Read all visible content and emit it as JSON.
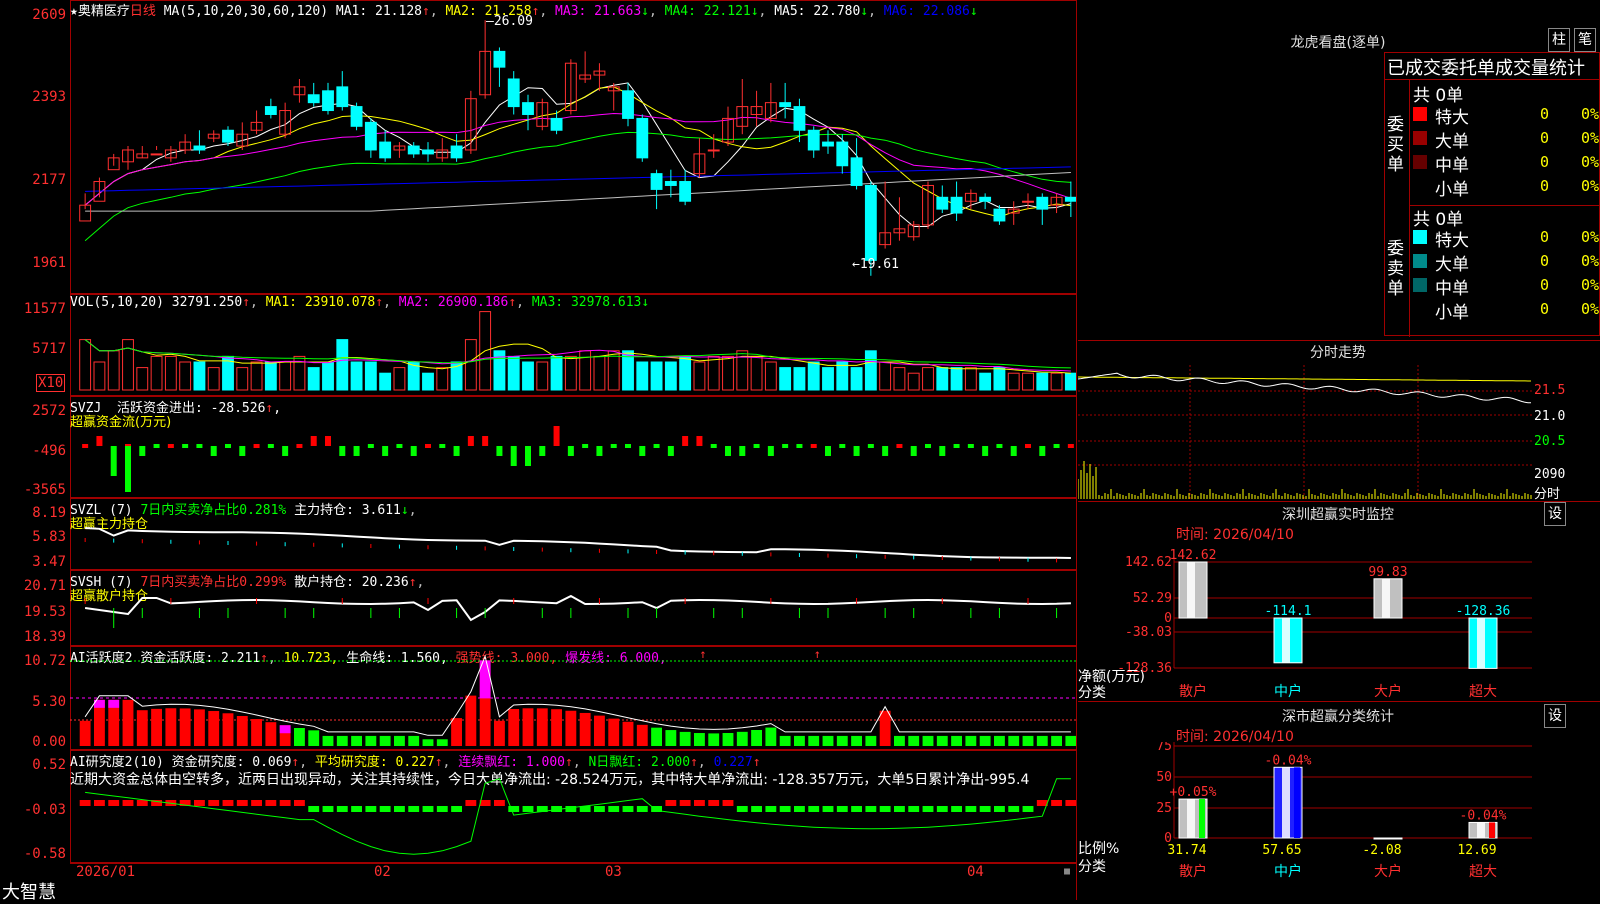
{
  "stock": {
    "name": "奥精医疗",
    "period": "日线",
    "star": "★"
  },
  "ma_header": {
    "label": "MA(5,10,20,30,60,120)",
    "ma1": "MA1: 21.128",
    "ma2": "MA2: 21.258",
    "ma3": "MA3: 21.663",
    "ma4": "MA4: 22.121",
    "ma5": "MA5: 22.780",
    "ma6": "MA6: 22.086"
  },
  "price_axis": [
    "2609",
    "2393",
    "2177",
    "1961"
  ],
  "annotations": {
    "high": "26.09",
    "low": "19.61"
  },
  "vol_header": {
    "label": "VOL(5,10,20)",
    "value": "32791.250",
    "ma1": "MA1: 23910.078",
    "ma2": "MA2: 26900.186",
    "ma3": "MA3: 32978.613"
  },
  "vol_axis": [
    "11577",
    "5717"
  ],
  "vol_unit": "X10",
  "svzj": {
    "label": "SVZJ",
    "text": "活跃资金进出: -28.526",
    "sub": "超赢资金流(万元)",
    "axis": [
      "2572",
      "-496",
      "-3565"
    ]
  },
  "svzl": {
    "label": "SVZL (7)",
    "text1": "7日内买卖净占比0.281%",
    "text2": "主力持仓: 3.611",
    "sub": "超赢主力持仓",
    "axis": [
      "8.19",
      "5.83",
      "3.47"
    ]
  },
  "svsh": {
    "label": "SVSH (7)",
    "text1": "7日内买卖净占比0.299%",
    "text2": "散户持仓: 20.236",
    "sub": "超赢散户持仓",
    "axis": [
      "20.71",
      "19.53",
      "18.39"
    ]
  },
  "ai1": {
    "label": "AI活跃度2",
    "t1": "资金活跃度: 2.211",
    "t2": "10.723,",
    "t3": "生命线: 1.560,",
    "t4": "强势线: 3.000,",
    "t5": "爆发线: 6.000,",
    "axis": [
      "10.72",
      "5.30",
      "0.00"
    ]
  },
  "ai2": {
    "label": "AI研究度2(10)",
    "t1": "资金研究度: 0.069",
    "t2": "平均研究度: 0.227",
    "t3": "连续飘红: 1.000",
    "t4": "N日飘红: 2.000",
    "t5": "0.227",
    "comment": "近期大资金总体由空转多，近两日出现异动，关注其持续性，今日大单净流出: -28.524万元，其中特大单净流出: -128.357万元，大单5日累计净出-995.4",
    "axis": [
      "0.52",
      "-0.03",
      "-0.58"
    ]
  },
  "date_axis": [
    "2026/01",
    "02",
    "03",
    "04"
  ],
  "brand": "大智慧",
  "right": {
    "lh_title": "龙虎看盘(逐单)",
    "btn_bar": "柱",
    "btn_pen": "笔",
    "stats_title": "已成交委托单成交量统计",
    "buy_label": "委买单",
    "sell_label": "委卖单",
    "buy_total": "共 0单",
    "sell_total": "共 0单",
    "buy_rows": [
      {
        "name": "特大",
        "count": "0",
        "pct": "0%",
        "color": "#ff0000"
      },
      {
        "name": "大单",
        "count": "0",
        "pct": "0%",
        "color": "#990000"
      },
      {
        "name": "中单",
        "count": "0",
        "pct": "0%",
        "color": "#660000"
      },
      {
        "name": "小单",
        "count": "0",
        "pct": "0%",
        "color": "#000000"
      }
    ],
    "sell_rows": [
      {
        "name": "特大",
        "count": "0",
        "pct": "0%",
        "color": "#00ffff"
      },
      {
        "name": "大单",
        "count": "0",
        "pct": "0%",
        "color": "#008b8b"
      },
      {
        "name": "中单",
        "count": "0",
        "pct": "0%",
        "color": "#006666"
      },
      {
        "name": "小单",
        "count": "0",
        "pct": "0%",
        "color": "#000000"
      }
    ],
    "fs_title": "分时走势",
    "fs_axis": [
      "21.5",
      "21.0",
      "20.5"
    ],
    "fs_vol": [
      "2090",
      "分时"
    ],
    "sz_title": "深圳超赢实时监控",
    "sz_time": "时间: 2026/04/10",
    "sz_axis": [
      "142.62",
      "52.29",
      "0",
      "-38.03",
      "-128.36"
    ],
    "sz_ylabel": "净额(万元)",
    "sz_xlabel": "分类",
    "sz_bars": [
      {
        "cat": "散户",
        "value": 142.62,
        "label": "142.62"
      },
      {
        "cat": "中户",
        "value": -114.1,
        "label": "-114.1"
      },
      {
        "cat": "大户",
        "value": 99.83,
        "label": "99.83"
      },
      {
        "cat": "超大",
        "value": -128.36,
        "label": "-128.36"
      }
    ],
    "sc_title": "深市超赢分类统计",
    "sc_time": "时间: 2026/04/10",
    "sc_axis": [
      "75",
      "50",
      "25",
      "0"
    ],
    "sc_ylabel": "比例%",
    "sc_xlabel": "分类",
    "sc_bars": [
      {
        "cat": "散户",
        "value": 31.74,
        "label": "31.74",
        "change": "+0.05%"
      },
      {
        "cat": "中户",
        "value": 57.65,
        "label": "57.65",
        "change": "-0.04%"
      },
      {
        "cat": "大户",
        "value": -2.08,
        "label": "-2.08",
        "change": ""
      },
      {
        "cat": "超大",
        "value": 12.69,
        "label": "12.69",
        "change": "-0.04%"
      }
    ],
    "btn_set": "设"
  },
  "colors": {
    "up": "#ff3030",
    "down": "#00ffff",
    "ma_white": "#ffffff",
    "ma_yellow": "#ffff00",
    "ma_magenta": "#ff00ff",
    "ma_green": "#00ff00",
    "ma_blue": "#0000ff",
    "ma_gray": "#c0c0c0"
  },
  "chart_data": {
    "type": "candlestick",
    "candles": [
      [
        21.0,
        21.4,
        21.3,
        21.7
      ],
      [
        21.5,
        22.0,
        21.6,
        22.1
      ],
      [
        22.3,
        22.6,
        22.4,
        22.7
      ],
      [
        22.5,
        22.8,
        22.3,
        22.9
      ],
      [
        22.6,
        22.7,
        22.6,
        22.9
      ],
      [
        22.7,
        22.7,
        22.8,
        22.9
      ],
      [
        22.6,
        22.8,
        22.5,
        22.9
      ],
      [
        22.8,
        23.0,
        22.7,
        23.2
      ],
      [
        22.9,
        22.8,
        22.7,
        23.3
      ],
      [
        23.1,
        23.2,
        23.0,
        23.3
      ],
      [
        23.3,
        23.0,
        22.9,
        23.4
      ],
      [
        22.9,
        23.2,
        22.8,
        23.5
      ],
      [
        23.3,
        23.5,
        23.2,
        23.8
      ],
      [
        23.9,
        23.7,
        23.6,
        24.1
      ],
      [
        23.2,
        23.8,
        23.1,
        24.0
      ],
      [
        24.2,
        24.4,
        24.0,
        24.6
      ],
      [
        24.2,
        24.0,
        23.9,
        24.5
      ],
      [
        24.3,
        23.8,
        23.7,
        24.5
      ],
      [
        24.4,
        23.9,
        23.8,
        24.8
      ],
      [
        23.9,
        23.4,
        23.3,
        24.0
      ],
      [
        23.5,
        22.8,
        22.6,
        23.6
      ],
      [
        23.0,
        22.6,
        22.5,
        23.3
      ],
      [
        22.8,
        22.9,
        22.6,
        23.0
      ],
      [
        22.9,
        22.7,
        22.6,
        23.0
      ],
      [
        22.8,
        22.7,
        22.5,
        23.0
      ],
      [
        22.6,
        22.8,
        22.5,
        23.1
      ],
      [
        22.9,
        22.6,
        22.5,
        23.2
      ],
      [
        22.8,
        24.1,
        22.7,
        24.3
      ],
      [
        24.2,
        25.3,
        24.1,
        26.09
      ],
      [
        25.3,
        24.9,
        24.4,
        25.4
      ],
      [
        24.6,
        23.9,
        23.7,
        24.8
      ],
      [
        24.0,
        23.7,
        23.3,
        24.2
      ],
      [
        23.4,
        24.0,
        23.3,
        24.1
      ],
      [
        23.6,
        23.3,
        23.2,
        23.8
      ],
      [
        23.8,
        25.0,
        23.7,
        25.1
      ],
      [
        24.6,
        24.7,
        24.5,
        25.3
      ],
      [
        24.7,
        24.8,
        24.3,
        25.0
      ],
      [
        24.3,
        24.4,
        23.8,
        24.5
      ],
      [
        24.3,
        23.6,
        23.4,
        24.5
      ],
      [
        23.6,
        22.6,
        22.5,
        23.7
      ],
      [
        22.2,
        21.8,
        21.3,
        22.3
      ],
      [
        22.0,
        21.9,
        21.6,
        22.3
      ],
      [
        22.0,
        21.5,
        21.4,
        22.3
      ],
      [
        22.2,
        22.7,
        22.1,
        23.1
      ],
      [
        22.8,
        22.8,
        22.6,
        23.2
      ],
      [
        23.0,
        23.6,
        22.9,
        23.9
      ],
      [
        23.4,
        23.9,
        23.2,
        24.6
      ],
      [
        23.7,
        23.9,
        23.4,
        24.3
      ],
      [
        23.6,
        24.0,
        23.5,
        24.5
      ],
      [
        24.0,
        23.9,
        23.6,
        24.5
      ],
      [
        23.9,
        23.3,
        23.0,
        24.1
      ],
      [
        23.3,
        22.8,
        22.6,
        23.4
      ],
      [
        23.0,
        22.9,
        22.7,
        23.3
      ],
      [
        23.0,
        22.4,
        22.2,
        23.2
      ],
      [
        22.6,
        21.9,
        21.8,
        23.1
      ],
      [
        21.9,
        20.0,
        19.61,
        22.0
      ],
      [
        20.4,
        20.7,
        20.3,
        22.0
      ],
      [
        20.7,
        20.8,
        20.5,
        21.6
      ],
      [
        20.6,
        20.9,
        20.5,
        21.0
      ],
      [
        20.9,
        21.9,
        20.8,
        22.0
      ],
      [
        21.6,
        21.3,
        21.2,
        21.9
      ],
      [
        21.6,
        21.2,
        21.0,
        22.0
      ],
      [
        21.5,
        21.7,
        21.3,
        21.8
      ],
      [
        21.6,
        21.5,
        21.3,
        21.7
      ],
      [
        21.3,
        21.0,
        20.9,
        21.4
      ],
      [
        21.2,
        21.3,
        20.9,
        21.5
      ],
      [
        21.5,
        21.5,
        21.3,
        21.7
      ],
      [
        21.6,
        21.3,
        20.9,
        21.7
      ],
      [
        21.4,
        21.6,
        21.2,
        21.7
      ],
      [
        21.6,
        21.5,
        21.1,
        22.0
      ]
    ],
    "volume": [
      9,
      5,
      7,
      9,
      4,
      6,
      6,
      5,
      5,
      4,
      6,
      4,
      5,
      5,
      5,
      6,
      4,
      5,
      9,
      5,
      5,
      3,
      4,
      5,
      3,
      4,
      5,
      9,
      14,
      7,
      6,
      5,
      5,
      6,
      6,
      7,
      6,
      7,
      7,
      5,
      5,
      5,
      6,
      5,
      6,
      6,
      7,
      6,
      5,
      4,
      4,
      5,
      4,
      5,
      4,
      7,
      5,
      4,
      3,
      4,
      4,
      4,
      4,
      3,
      4,
      3,
      3,
      3,
      3,
      3
    ],
    "svzj": [
      0,
      1,
      -3,
      0,
      -1,
      0,
      0,
      0,
      0,
      -1,
      0,
      -1,
      0,
      0,
      -1,
      0,
      1,
      1,
      -1,
      -1,
      0,
      -1,
      0,
      -1,
      0,
      0,
      -1,
      1,
      1,
      -1,
      -2,
      -2,
      -1,
      2,
      -1,
      0,
      -1,
      0,
      0,
      -1,
      0,
      -1,
      1,
      1,
      0,
      -1,
      -1,
      0,
      -1,
      0,
      0,
      0,
      -1,
      0,
      -1,
      0,
      -1,
      0,
      -1,
      0,
      -1,
      0,
      0,
      -1,
      0,
      -1,
      0,
      -1,
      0,
      0
    ],
    "x_dates": [
      "2026/01",
      "02",
      "03",
      "04"
    ]
  }
}
